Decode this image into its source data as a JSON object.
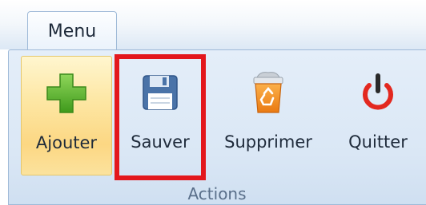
{
  "tab_bar": {
    "active_tab": "Menu"
  },
  "ribbon": {
    "buttons": [
      {
        "id": "add",
        "label": "Ajouter",
        "icon": "plus-icon",
        "state": "hover"
      },
      {
        "id": "save",
        "label": "Sauver",
        "icon": "floppy-disk-icon",
        "state": "highlighted"
      },
      {
        "id": "delete",
        "label": "Supprimer",
        "icon": "recycle-bin-icon"
      },
      {
        "id": "quit",
        "label": "Quitter",
        "icon": "power-icon"
      }
    ],
    "group_label": "Actions"
  },
  "colors": {
    "highlight_border": "#e3171c",
    "hover_background": "#fcd783",
    "ribbon_background": "#dae7f5",
    "plus_green": "#5cb82e",
    "power_red": "#e3281f",
    "recycle_orange": "#f08a24",
    "floppy_blue": "#4a73a8"
  }
}
